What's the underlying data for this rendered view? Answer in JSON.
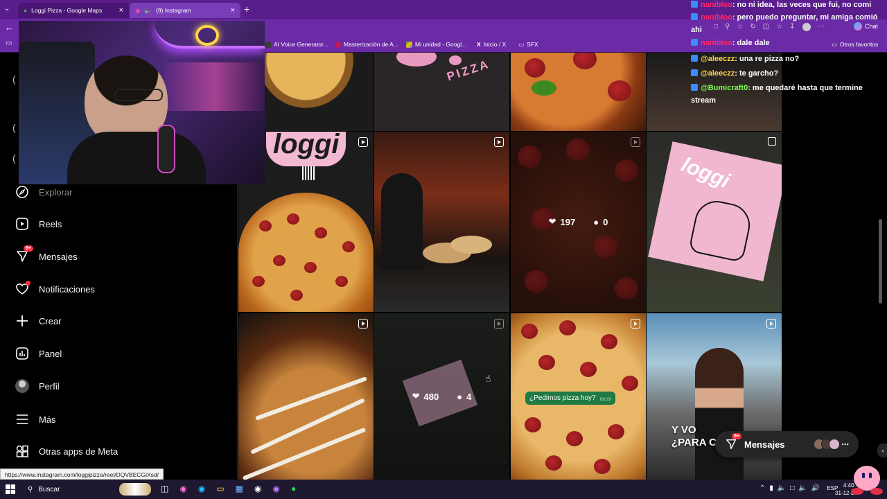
{
  "browser": {
    "tabs": [
      {
        "title": "Loggi Pizza - Google Maps",
        "active": false
      },
      {
        "title": "(9) Instagram",
        "active": true
      }
    ],
    "bookmarks": [
      "AI Voice Generator...",
      "Masterización de A...",
      "Mi unidad - Googl...",
      "Inicio / X",
      "SFX"
    ],
    "other_favorites": "Otros favoritos",
    "chat_button": "Chat",
    "status_url": "https://www.instagram.com/loggipizza/reel/DQVBECGiXsd/"
  },
  "sidebar": {
    "items": [
      {
        "label": "Explorar",
        "icon": "compass-icon"
      },
      {
        "label": "Reels",
        "icon": "reels-icon"
      },
      {
        "label": "Mensajes",
        "icon": "messenger-icon",
        "badge": "9+"
      },
      {
        "label": "Notificaciones",
        "icon": "heart-icon"
      },
      {
        "label": "Crear",
        "icon": "plus-icon"
      },
      {
        "label": "Panel",
        "icon": "chart-icon"
      },
      {
        "label": "Perfil",
        "icon": "avatar-icon"
      },
      {
        "label": "Más",
        "icon": "menu-icon"
      },
      {
        "label": "Otras apps de Meta",
        "icon": "apps-icon"
      }
    ]
  },
  "grid": {
    "posts": [
      {
        "id": "p1",
        "reel": false
      },
      {
        "id": "p2",
        "text": "PIZZA",
        "reel": false
      },
      {
        "id": "p3",
        "reel": false
      },
      {
        "id": "p4",
        "reel": false
      },
      {
        "id": "p5",
        "text": "loggi",
        "reel": true
      },
      {
        "id": "p6",
        "reel": true
      },
      {
        "id": "p7",
        "reel": true,
        "likes": "197",
        "comments": "0"
      },
      {
        "id": "p8",
        "text": "loggi",
        "reel": false
      },
      {
        "id": "p9",
        "reel": true
      },
      {
        "id": "p10",
        "reel": true,
        "likes": "480",
        "comments": "4"
      },
      {
        "id": "p11",
        "reel": true,
        "bubble": "¿Pedimos pizza hoy?",
        "bubble_time": "09:29"
      },
      {
        "id": "p12",
        "reel": true,
        "overlay": "Y VO\n¿PARA C"
      }
    ]
  },
  "messages_pill": {
    "label": "Mensajes",
    "badge": "9+"
  },
  "chat": {
    "lines": [
      {
        "user": "nanibloo",
        "text": ": no ni idea, las veces que fui, no comi"
      },
      {
        "user": "nanibloo",
        "text": ": pero puedo preguntar, mi amiga comió ahi"
      },
      {
        "user": "nanibloo",
        "text": ": dale dale"
      },
      {
        "user": "@aleeczz",
        "text": ": una re pizza no?"
      },
      {
        "user": "@aleeczz",
        "text": ": te garcho?"
      },
      {
        "user": "@Bumicraft0",
        "text": ": me quedaré hasta que termine stream"
      }
    ],
    "user_colors": {
      "nanibloo": "#ff2a6d",
      "@aleeczz": "#ffd24a",
      "@Bumicraft0": "#7cff4f"
    }
  },
  "taskbar": {
    "search": "Buscar",
    "lang": "ESP",
    "time": "4:40",
    "date": "31-12-2"
  }
}
